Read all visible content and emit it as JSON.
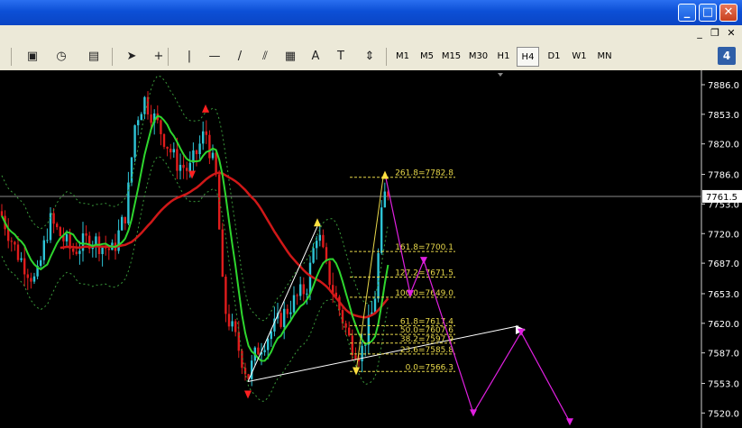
{
  "window": {
    "minimize": "_",
    "maximize": "□",
    "close": "✕"
  },
  "mdi": {
    "minimize": "_",
    "restore": "❐",
    "close": "✕"
  },
  "toolbar": {
    "tools": [
      {
        "name": "new-order-icon",
        "glyph": "▣"
      },
      {
        "name": "clock-icon",
        "glyph": "◷"
      },
      {
        "name": "chart-template-icon",
        "glyph": "▤"
      },
      {
        "name": "cursor-icon",
        "glyph": "➤"
      },
      {
        "name": "crosshair-icon",
        "glyph": "+"
      },
      {
        "name": "vertical-line-icon",
        "glyph": "|"
      },
      {
        "name": "horizontal-line-icon",
        "glyph": "—"
      },
      {
        "name": "trendline-icon",
        "glyph": "/"
      },
      {
        "name": "channel-icon",
        "glyph": "⫽"
      },
      {
        "name": "fibonacci-icon",
        "glyph": "▦"
      },
      {
        "name": "text-icon",
        "glyph": "A"
      },
      {
        "name": "text-label-icon",
        "glyph": "T"
      },
      {
        "name": "arrows-icon",
        "glyph": "⇕"
      }
    ],
    "timeframes": [
      "M1",
      "M5",
      "M15",
      "M30",
      "H1",
      "H4",
      "D1",
      "W1",
      "MN"
    ],
    "active_timeframe": "H4",
    "badge": "4"
  },
  "chart_data": {
    "type": "candlestick",
    "ylim": [
      7500,
      7900
    ],
    "y_ticks": [
      "7886.0",
      "7853.0",
      "7820.0",
      "7786.0",
      "7753.0",
      "7720.0",
      "7687.0",
      "7653.0",
      "7620.0",
      "7587.0",
      "7553.0",
      "7520.0"
    ],
    "current_price": "7761.5",
    "fib_levels": [
      {
        "label": "261.8=7782.8",
        "value": 7782.8
      },
      {
        "label": "161.8=7700.1",
        "value": 7700.1
      },
      {
        "label": "127.2=7671.5",
        "value": 7671.5
      },
      {
        "label": "100.0=7649.0",
        "value": 7649.0
      },
      {
        "label": "61.8=7617.4",
        "value": 7617.4
      },
      {
        "label": "50.0=7607.6",
        "value": 7607.6
      },
      {
        "label": "38.2=7597.9",
        "value": 7597.9
      },
      {
        "label": "23.6=7585.8",
        "value": 7585.8
      },
      {
        "label": "0.0=7566.3",
        "value": 7566.3
      }
    ],
    "colors": {
      "background": "#000000",
      "bull": "#2ec4d6",
      "bear": "#e01c1c",
      "fast_ma": "#2ed62e",
      "slow_ma": "#d01818",
      "envelope": "#3a9a3a",
      "fib": "#e8d84a",
      "forecast": "#e020e0",
      "trendline": "#ffffff",
      "axis_text": "#ffffff",
      "grid": "#8a8a8a"
    }
  }
}
